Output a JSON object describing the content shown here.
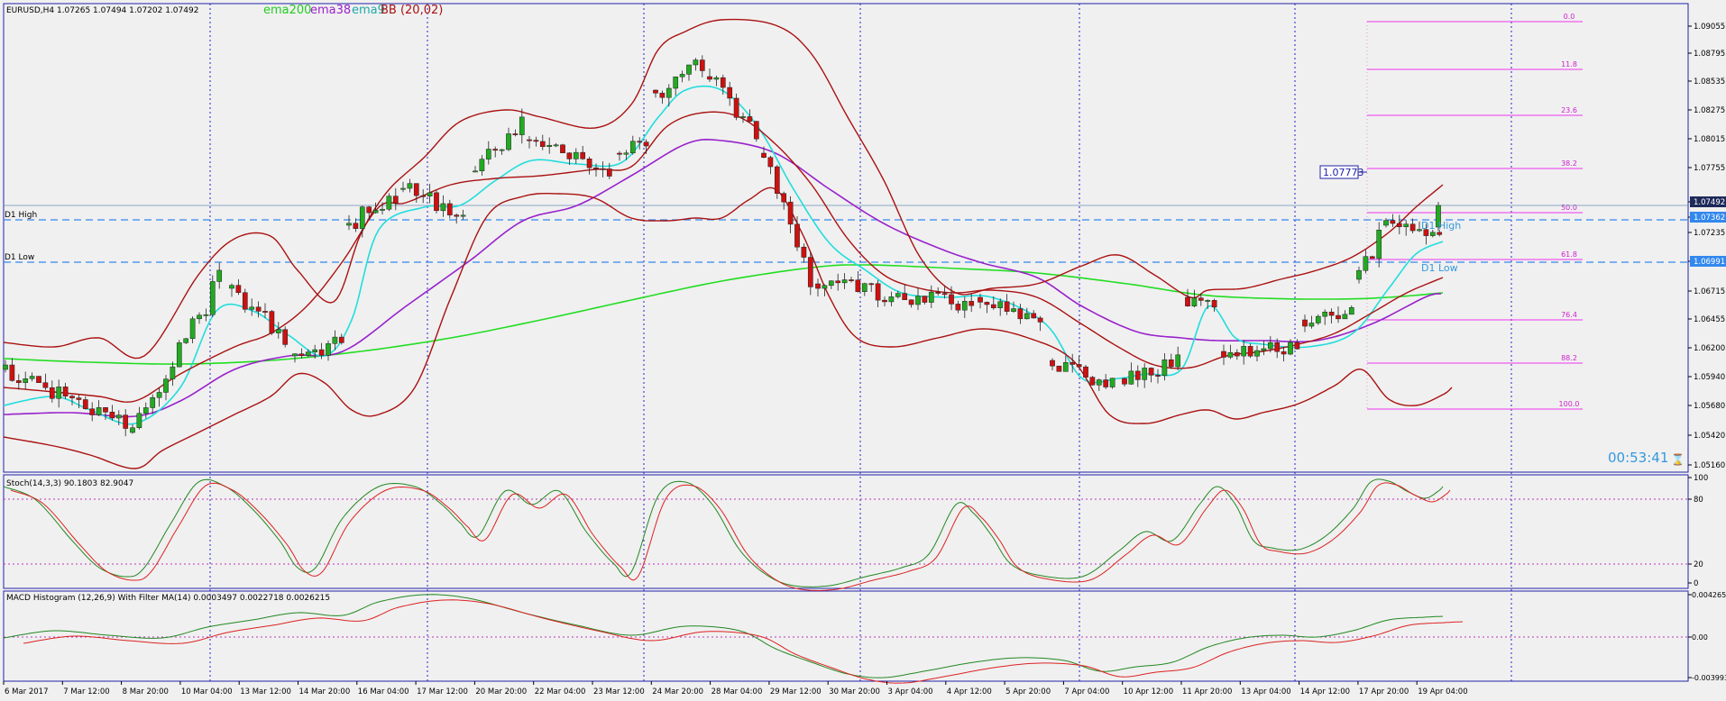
{
  "main": {
    "header": "EURUSD,H4  1.07265 1.07494 1.07202 1.07492",
    "legend": [
      {
        "label": "ema200",
        "color": "#22cc22"
      },
      {
        "label": "ema38",
        "color": "#9922cc"
      },
      {
        "label": "ema9",
        "color": "#22dddd"
      },
      {
        "label": "BB (20,02)",
        "color": "#aa1111"
      }
    ],
    "timer": "00:53:41",
    "d1_high_label": "D1 High",
    "d1_low_label": "D1 Low",
    "d1_high_value": 1.07362,
    "d1_low_value": 1.06991,
    "current_price": 1.07492,
    "price_box": "1.07773",
    "fib_levels": [
      "0.0",
      "11.8",
      "23.6",
      "38.2",
      "50.0",
      "61.8",
      "76.4",
      "88.2",
      "100.0"
    ],
    "price_min": 1.0516,
    "price_max": 1.0918,
    "price_ticks": [
      "1.09055",
      "1.08795",
      "1.08535",
      "1.08275",
      "1.08015",
      "1.07755",
      "1.07492",
      "1.07362",
      "1.07235",
      "1.06991",
      "1.06715",
      "1.06455",
      "1.06200",
      "1.05940",
      "1.05680",
      "1.05420",
      "1.05160"
    ]
  },
  "stoch": {
    "header": "Stoch(14,3,3) 90.1803 82.9047",
    "ticks": [
      "100",
      "80",
      "20",
      "0"
    ]
  },
  "macd": {
    "header": "MACD Histogram (12,26,9) With Filter MA(14) 0.0003497 0.0022718 0.0026215",
    "ticks": [
      "0.004265",
      "0.00",
      "-0.003993"
    ]
  },
  "time_axis": [
    "6 Mar 2017",
    "7 Mar 12:00",
    "8 Mar 20:00",
    "10 Mar 04:00",
    "13 Mar 12:00",
    "14 Mar 20:00",
    "16 Mar 04:00",
    "17 Mar 12:00",
    "20 Mar 20:00",
    "22 Mar 04:00",
    "23 Mar 12:00",
    "24 Mar 20:00",
    "28 Mar 04:00",
    "29 Mar 12:00",
    "30 Mar 20:00",
    "3 Apr 04:00",
    "4 Apr 12:00",
    "5 Apr 20:00",
    "7 Apr 04:00",
    "10 Apr 12:00",
    "11 Apr 20:00",
    "13 Apr 04:00",
    "14 Apr 12:00",
    "17 Apr 20:00",
    "19 Apr 04:00"
  ],
  "colors": {
    "bull": "#22aa22",
    "bear": "#cc1111",
    "ema200": "#22dd22",
    "ema38": "#9922cc",
    "ema9": "#22dddd",
    "bb": "#aa1111",
    "fib": "#ee33ee",
    "d1": "#3388ee",
    "axis": "#2222aa",
    "stoch_k": "#228822",
    "stoch_d": "#dd2222"
  }
}
